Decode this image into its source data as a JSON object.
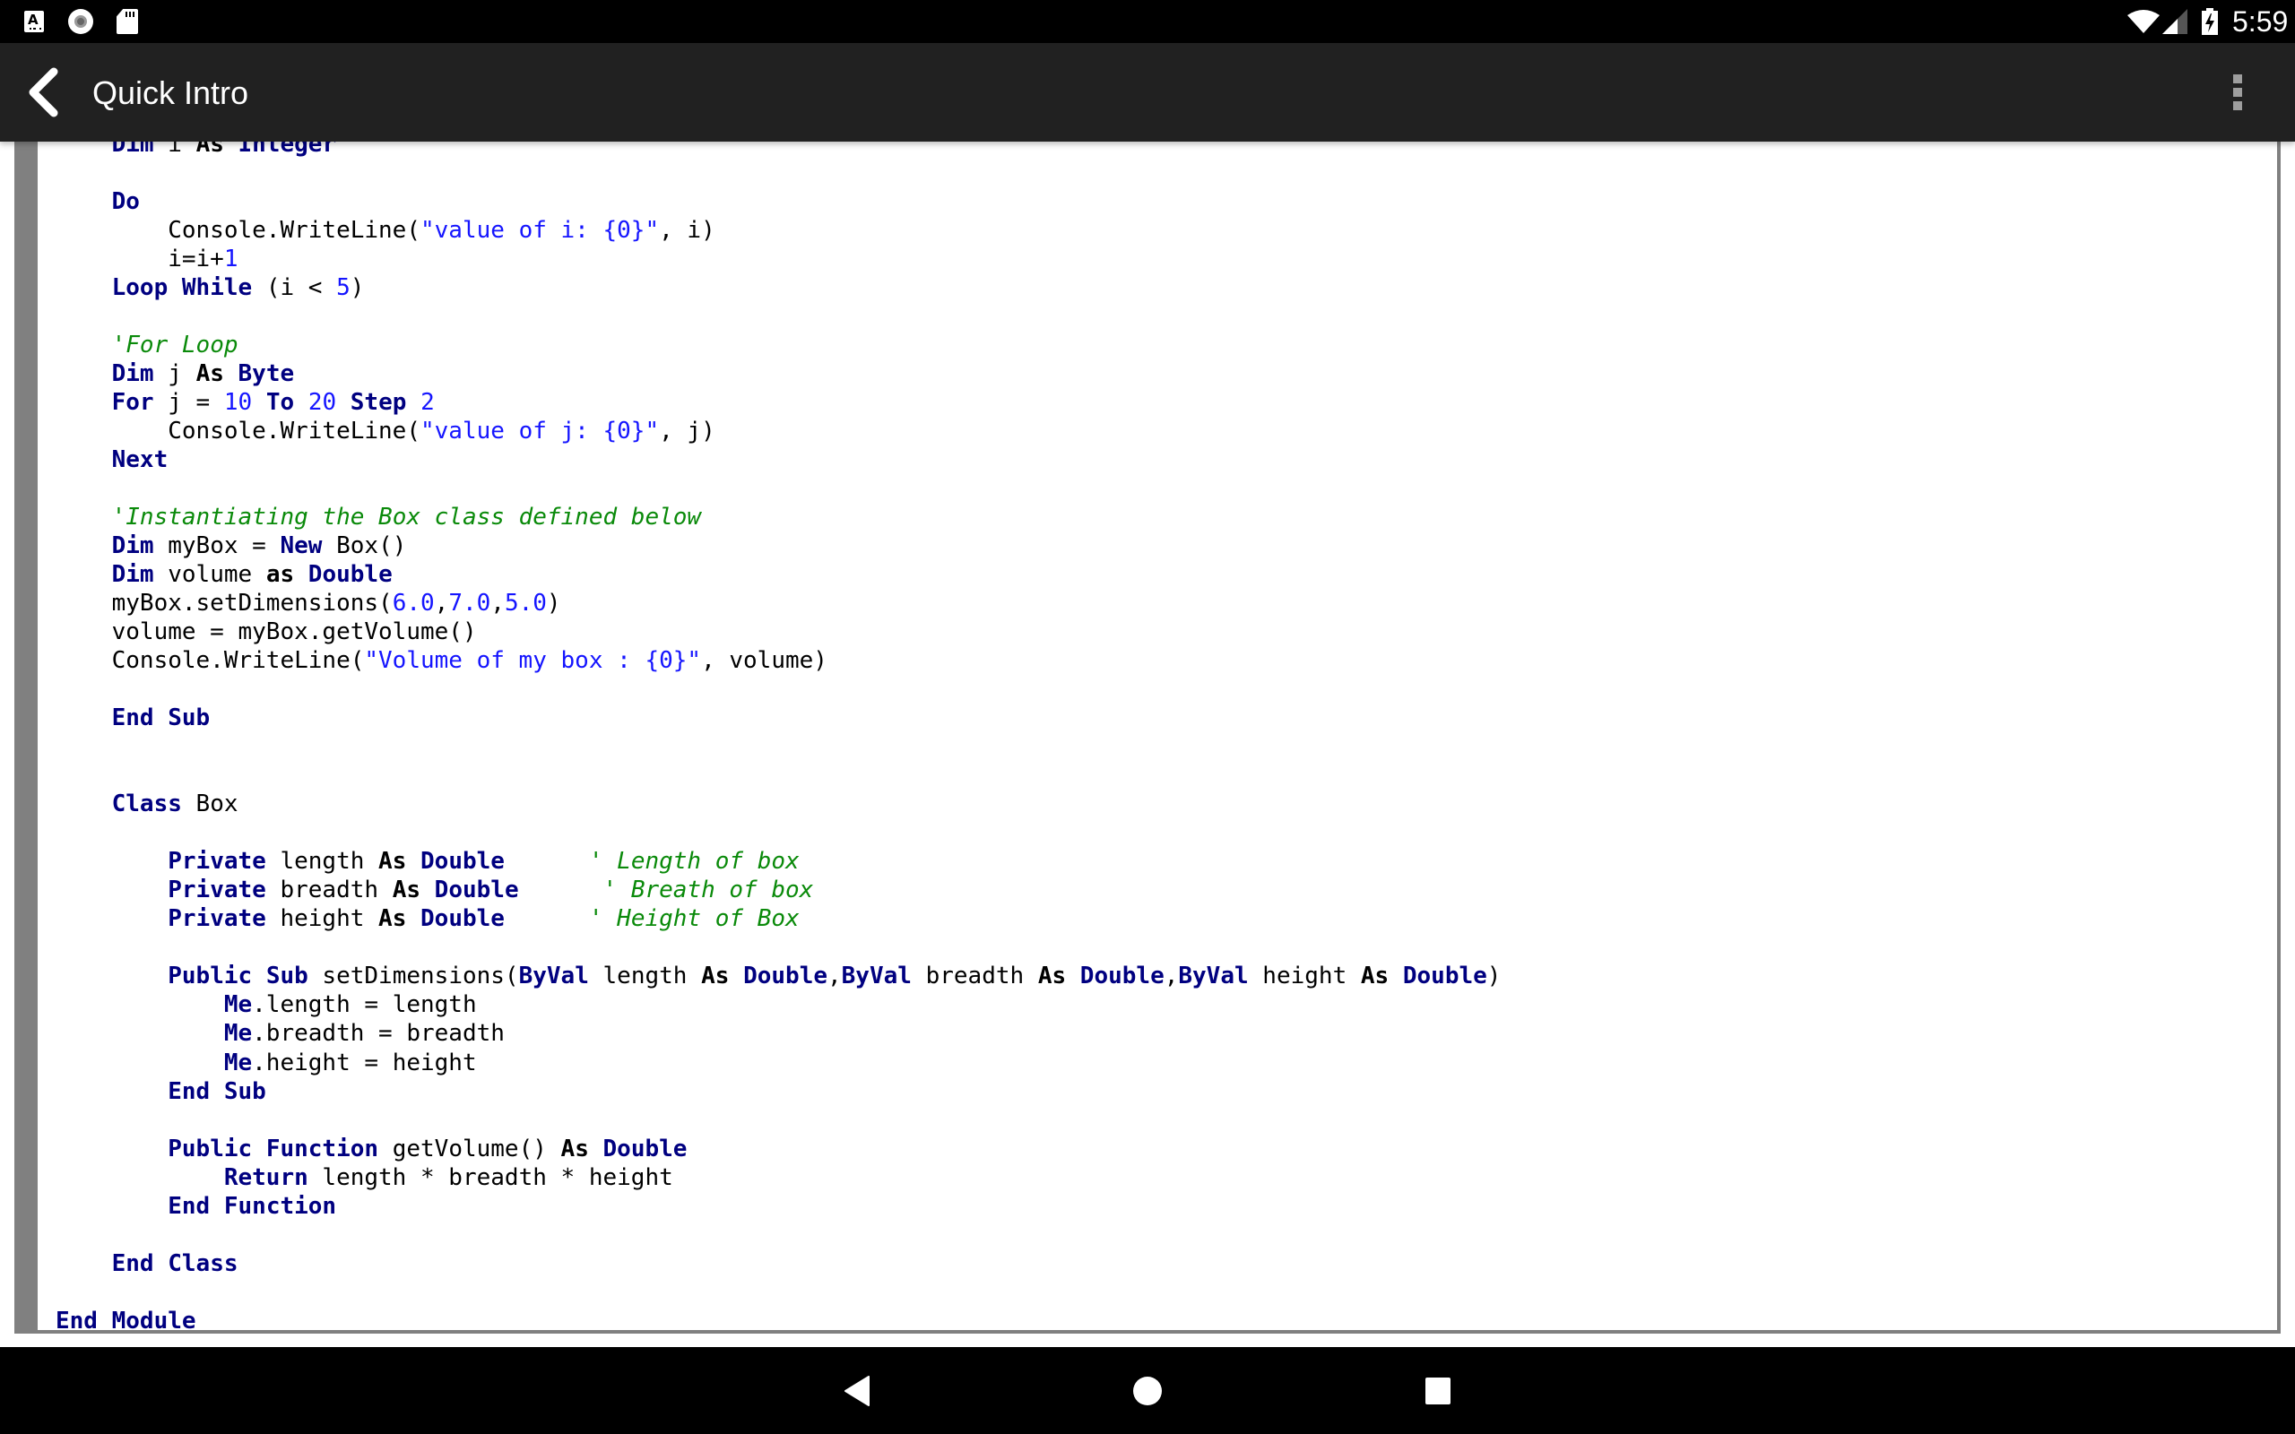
{
  "status_bar": {
    "left_icons": [
      "keyboard-a-icon",
      "record-icon",
      "sd-card-icon"
    ],
    "right_icons": [
      "wifi-icon",
      "cell-signal-icon",
      "battery-charging-icon"
    ],
    "time": "5:59"
  },
  "app_bar": {
    "back_icon": "chevron-left-icon",
    "title": "Quick Intro",
    "overflow_icon": "more-vert-icon"
  },
  "code": {
    "language": "VB.NET",
    "lines": [
      [
        [
          "    ",
          ""
        ],
        [
          "Dim",
          "kw"
        ],
        [
          " i ",
          ""
        ],
        [
          "As",
          "kb"
        ],
        [
          " ",
          ""
        ],
        [
          "Integer",
          "kw"
        ]
      ],
      [
        [
          "",
          ""
        ]
      ],
      [
        [
          "    ",
          ""
        ],
        [
          "Do",
          "kw"
        ]
      ],
      [
        [
          "        Console.WriteLine(",
          ""
        ],
        [
          "\"value of i: {0}\"",
          "str"
        ],
        [
          ", i)",
          ""
        ]
      ],
      [
        [
          "        i=i+",
          ""
        ],
        [
          "1",
          "num"
        ]
      ],
      [
        [
          "    ",
          ""
        ],
        [
          "Loop",
          "kw"
        ],
        [
          " ",
          ""
        ],
        [
          "While",
          "kw"
        ],
        [
          " (i < ",
          ""
        ],
        [
          "5",
          "num"
        ],
        [
          ")",
          ""
        ]
      ],
      [
        [
          "",
          ""
        ]
      ],
      [
        [
          "    ",
          ""
        ],
        [
          "'For Loop",
          "cm"
        ]
      ],
      [
        [
          "    ",
          ""
        ],
        [
          "Dim",
          "kw"
        ],
        [
          " j ",
          ""
        ],
        [
          "As",
          "kb"
        ],
        [
          " ",
          ""
        ],
        [
          "Byte",
          "kw"
        ]
      ],
      [
        [
          "    ",
          ""
        ],
        [
          "For",
          "kw"
        ],
        [
          " j = ",
          ""
        ],
        [
          "10",
          "num"
        ],
        [
          " ",
          ""
        ],
        [
          "To",
          "kw"
        ],
        [
          " ",
          ""
        ],
        [
          "20",
          "num"
        ],
        [
          " ",
          ""
        ],
        [
          "Step",
          "kw"
        ],
        [
          " ",
          ""
        ],
        [
          "2",
          "num"
        ]
      ],
      [
        [
          "        Console.WriteLine(",
          ""
        ],
        [
          "\"value of j: {0}\"",
          "str"
        ],
        [
          ", j)",
          ""
        ]
      ],
      [
        [
          "    ",
          ""
        ],
        [
          "Next",
          "kw"
        ]
      ],
      [
        [
          "",
          ""
        ]
      ],
      [
        [
          "    ",
          ""
        ],
        [
          "'Instantiating the Box class defined below",
          "cm"
        ]
      ],
      [
        [
          "    ",
          ""
        ],
        [
          "Dim",
          "kw"
        ],
        [
          " myBox = ",
          ""
        ],
        [
          "New",
          "kw"
        ],
        [
          " Box()",
          ""
        ]
      ],
      [
        [
          "    ",
          ""
        ],
        [
          "Dim",
          "kw"
        ],
        [
          " volume ",
          ""
        ],
        [
          "as",
          "kb"
        ],
        [
          " ",
          ""
        ],
        [
          "Double",
          "kw"
        ]
      ],
      [
        [
          "    myBox.setDimensions(",
          ""
        ],
        [
          "6.0",
          "num"
        ],
        [
          ",",
          ""
        ],
        [
          "7.0",
          "num"
        ],
        [
          ",",
          ""
        ],
        [
          "5.0",
          "num"
        ],
        [
          ")",
          ""
        ]
      ],
      [
        [
          "    volume = myBox.getVolume()",
          ""
        ]
      ],
      [
        [
          "    Console.WriteLine(",
          ""
        ],
        [
          "\"Volume of my box : {0}\"",
          "str"
        ],
        [
          ", volume)",
          ""
        ]
      ],
      [
        [
          "",
          ""
        ]
      ],
      [
        [
          "    ",
          ""
        ],
        [
          "End",
          "kw"
        ],
        [
          " ",
          ""
        ],
        [
          "Sub",
          "kw"
        ]
      ],
      [
        [
          "",
          ""
        ]
      ],
      [
        [
          "",
          ""
        ]
      ],
      [
        [
          "    ",
          ""
        ],
        [
          "Class",
          "kw"
        ],
        [
          " Box",
          ""
        ]
      ],
      [
        [
          "",
          ""
        ]
      ],
      [
        [
          "        ",
          ""
        ],
        [
          "Private",
          "kw"
        ],
        [
          " length ",
          ""
        ],
        [
          "As",
          "kb"
        ],
        [
          " ",
          ""
        ],
        [
          "Double",
          "kw"
        ],
        [
          "      ",
          ""
        ],
        [
          "' Length of box",
          "cm"
        ]
      ],
      [
        [
          "        ",
          ""
        ],
        [
          "Private",
          "kw"
        ],
        [
          " breadth ",
          ""
        ],
        [
          "As",
          "kb"
        ],
        [
          " ",
          ""
        ],
        [
          "Double",
          "kw"
        ],
        [
          "      ",
          ""
        ],
        [
          "' Breath of box",
          "cm"
        ]
      ],
      [
        [
          "        ",
          ""
        ],
        [
          "Private",
          "kw"
        ],
        [
          " height ",
          ""
        ],
        [
          "As",
          "kb"
        ],
        [
          " ",
          ""
        ],
        [
          "Double",
          "kw"
        ],
        [
          "      ",
          ""
        ],
        [
          "' Height of Box",
          "cm"
        ]
      ],
      [
        [
          "",
          ""
        ]
      ],
      [
        [
          "        ",
          ""
        ],
        [
          "Public",
          "kw"
        ],
        [
          " ",
          ""
        ],
        [
          "Sub",
          "kw"
        ],
        [
          " setDimensions(",
          ""
        ],
        [
          "ByVal",
          "kw"
        ],
        [
          " length ",
          ""
        ],
        [
          "As",
          "kb"
        ],
        [
          " ",
          ""
        ],
        [
          "Double",
          "kw"
        ],
        [
          ",",
          ""
        ],
        [
          "ByVal",
          "kw"
        ],
        [
          " breadth ",
          ""
        ],
        [
          "As",
          "kb"
        ],
        [
          " ",
          ""
        ],
        [
          "Double",
          "kw"
        ],
        [
          ",",
          ""
        ],
        [
          "ByVal",
          "kw"
        ],
        [
          " height ",
          ""
        ],
        [
          "As",
          "kb"
        ],
        [
          " ",
          ""
        ],
        [
          "Double",
          "kw"
        ],
        [
          ")",
          ""
        ]
      ],
      [
        [
          "            ",
          ""
        ],
        [
          "Me",
          "kw"
        ],
        [
          ".length = length",
          ""
        ]
      ],
      [
        [
          "            ",
          ""
        ],
        [
          "Me",
          "kw"
        ],
        [
          ".breadth = breadth",
          ""
        ]
      ],
      [
        [
          "            ",
          ""
        ],
        [
          "Me",
          "kw"
        ],
        [
          ".height = height",
          ""
        ]
      ],
      [
        [
          "        ",
          ""
        ],
        [
          "End",
          "kw"
        ],
        [
          " ",
          ""
        ],
        [
          "Sub",
          "kw"
        ]
      ],
      [
        [
          "",
          ""
        ]
      ],
      [
        [
          "        ",
          ""
        ],
        [
          "Public",
          "kw"
        ],
        [
          " ",
          ""
        ],
        [
          "Function",
          "kw"
        ],
        [
          " getVolume() ",
          ""
        ],
        [
          "As",
          "kb"
        ],
        [
          " ",
          ""
        ],
        [
          "Double",
          "kw"
        ]
      ],
      [
        [
          "            ",
          ""
        ],
        [
          "Return",
          "kw"
        ],
        [
          " length * breadth * height",
          ""
        ]
      ],
      [
        [
          "        ",
          ""
        ],
        [
          "End",
          "kw"
        ],
        [
          " ",
          ""
        ],
        [
          "Function",
          "kw"
        ]
      ],
      [
        [
          "",
          ""
        ]
      ],
      [
        [
          "    ",
          ""
        ],
        [
          "End",
          "kw"
        ],
        [
          " ",
          ""
        ],
        [
          "Class",
          "kw"
        ]
      ],
      [
        [
          "",
          ""
        ]
      ],
      [
        [
          "",
          ""
        ],
        [
          "End",
          "kw"
        ],
        [
          " ",
          ""
        ],
        [
          "Module",
          "kw"
        ]
      ]
    ]
  },
  "nav_bar": {
    "back_icon": "nav-back-icon",
    "home_icon": "nav-home-icon",
    "recents_icon": "nav-recents-icon"
  },
  "colors": {
    "keyword": "#000080",
    "string_number": "#1515ff",
    "comment": "#0a8a0a",
    "app_bar": "#212121",
    "code_border": "#808080"
  }
}
